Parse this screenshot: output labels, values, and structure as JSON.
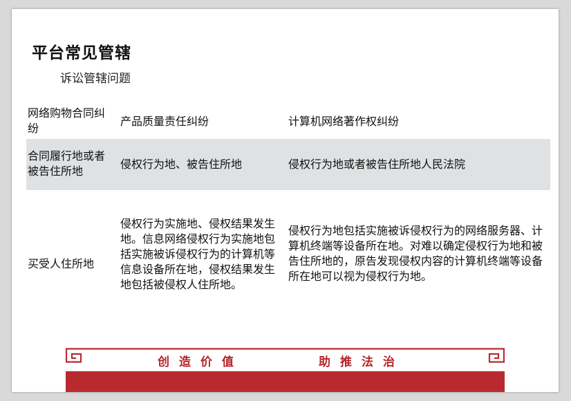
{
  "title": "平台常见管辖",
  "subtitle": "诉讼管辖问题",
  "rows": [
    {
      "col1": "网络购物合同纠纷",
      "col2": "产品质量责任纠纷",
      "col3": "计算机网络著作权纠纷"
    },
    {
      "col1": "合同履行地或者被告住所地",
      "col2": "侵权行为地、被告住所地",
      "col3": "侵权行为地或者被告住所地人民法院"
    },
    {
      "col1": "买受人住所地",
      "col2": "侵权行为实施地、侵权结果发生地。信息网络侵权行为实施地包括实施被诉侵权行为的计算机等信息设备所在地，侵权结果发生地包括被侵权人住所地。",
      "col3": "侵权行为地包括实施被诉侵权行为的网络服务器、计算机终端等设备所在地。对难以确定侵权行为地和被告住所地的，原告发现侵权内容的计算机终端等设备所在地可以视为侵权行为地。"
    }
  ],
  "footer": {
    "slogan_left": "创造价值",
    "slogan_right": "助推法治",
    "accent_color": "#b92a30"
  }
}
